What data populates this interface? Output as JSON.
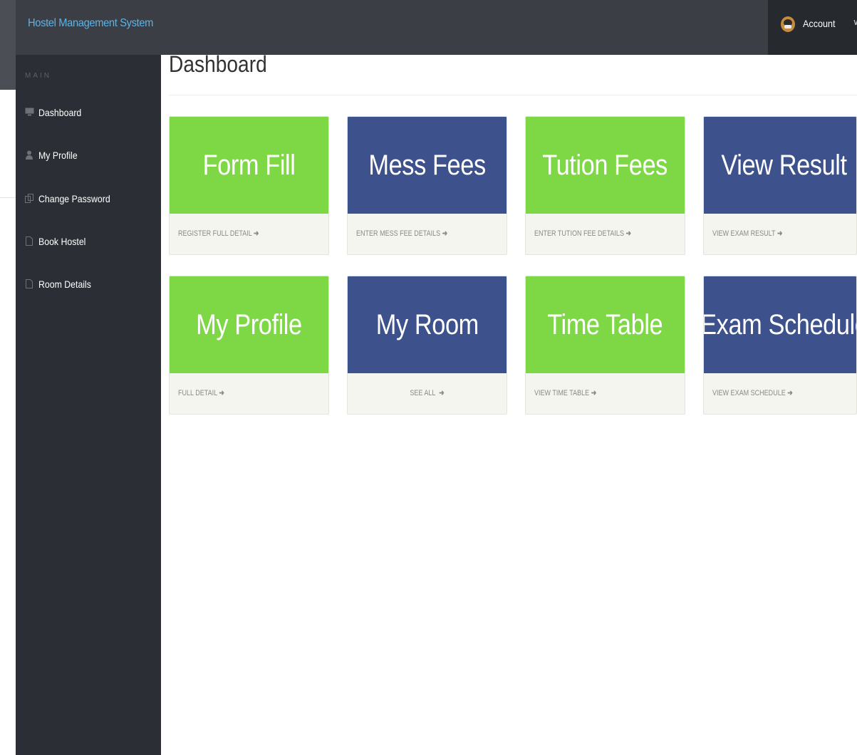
{
  "header": {
    "brand": "Hostel Management System",
    "account_label": "Account"
  },
  "sidebar": {
    "heading": "MAIN",
    "items": [
      {
        "label": "Dashboard",
        "icon": "monitor-icon"
      },
      {
        "label": "My Profile",
        "icon": "user-icon"
      },
      {
        "label": "Change Password",
        "icon": "copy-icon"
      },
      {
        "label": "Book Hostel",
        "icon": "file-icon"
      },
      {
        "label": "Room Details",
        "icon": "file-icon"
      }
    ]
  },
  "main": {
    "title": "Dashboard",
    "tiles": [
      {
        "title": "Form Fill",
        "link": "REGISTER FULL DETAIL",
        "color": "#7ed845"
      },
      {
        "title": "Mess Fees",
        "link": "ENTER MESS FEE DETAILS",
        "color": "#3d518c"
      },
      {
        "title": "Tution Fees",
        "link": "ENTER TUTION FEE DETAILS",
        "color": "#7ed845"
      },
      {
        "title": "View Result",
        "link": "VIEW EXAM RESULT",
        "color": "#3d518c"
      },
      {
        "title": "My Profile",
        "link": "FULL DETAIL",
        "color": "#7ed845"
      },
      {
        "title": "My Room",
        "link": "SEE ALL",
        "color": "#3d518c"
      },
      {
        "title": "Time Table",
        "link": "VIEW TIME TABLE",
        "color": "#7ed845"
      },
      {
        "title": "Exam Schedule",
        "link": "VIEW EXAM SCHEDULE",
        "color": "#3d518c"
      }
    ]
  },
  "colors": {
    "brand_text": "#5fb3e4",
    "sidebar_bg": "#2b2f35",
    "topbar_bg": "#3b3e44",
    "tile_green": "#7ed845",
    "tile_blue": "#3d518c"
  }
}
